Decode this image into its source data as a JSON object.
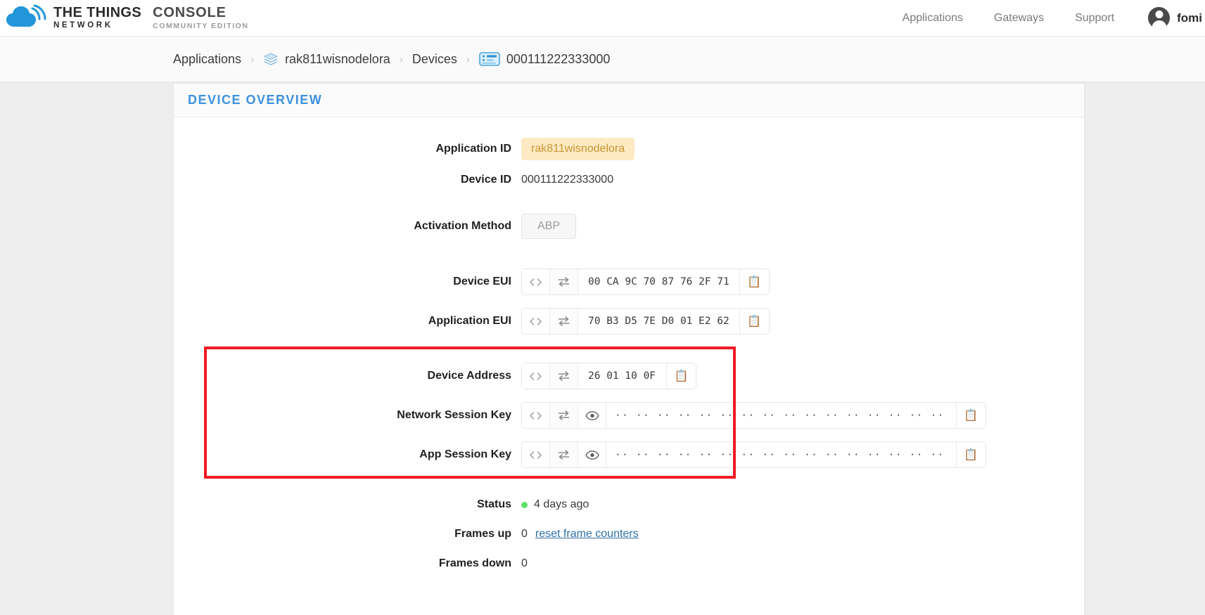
{
  "header": {
    "logo": {
      "icon": "ttn-cloud-icon",
      "line1": "THE THINGS",
      "line2": "NETWORK",
      "product_line1": "CONSOLE",
      "product_line2": "COMMUNITY EDITION"
    },
    "nav": [
      {
        "label": "Applications",
        "name": "nav-applications"
      },
      {
        "label": "Gateways",
        "name": "nav-gateways"
      },
      {
        "label": "Support",
        "name": "nav-support"
      }
    ],
    "user": {
      "name": "fomi",
      "avatar_icon": "user-avatar-icon"
    }
  },
  "breadcrumb": {
    "separator": "›",
    "items": [
      {
        "label": "Applications",
        "icon": null
      },
      {
        "label": "rak811wisnodelora",
        "icon": "layers-icon"
      },
      {
        "label": "Devices",
        "icon": null
      },
      {
        "label": "000111222333000",
        "icon": "device-chip-icon"
      }
    ]
  },
  "card": {
    "title": "DEVICE OVERVIEW"
  },
  "fields": {
    "application_id": {
      "label": "Application ID",
      "value": "rak811wisnodelora",
      "tag_bg": "#fdeac4",
      "tag_fg": "#c9962f"
    },
    "device_id": {
      "label": "Device ID",
      "value": "000111222333000"
    },
    "activation_method": {
      "label": "Activation Method",
      "value": "ABP"
    },
    "device_eui": {
      "label": "Device EUI",
      "value": "00 CA 9C 70 87 76 2F 71"
    },
    "application_eui": {
      "label": "Application EUI",
      "value": "70 B3 D5 7E D0 01 E2 62"
    },
    "device_address": {
      "label": "Device Address",
      "value": "26 01 10 0F"
    },
    "network_session_key": {
      "label": "Network Session Key",
      "value": "·· ·· ·· ·· ·· ·· ·· ·· ·· ·· ·· ·· ·· ·· ·· ··",
      "masked": true
    },
    "app_session_key": {
      "label": "App Session Key",
      "value": "·· ·· ·· ·· ·· ·· ·· ·· ·· ·· ·· ·· ·· ·· ·· ··",
      "masked": true
    },
    "status": {
      "label": "Status",
      "value": "4 days ago",
      "dot_color": "#5fe06a"
    },
    "frames_up": {
      "label": "Frames up",
      "value": "0",
      "link_label": "reset frame counters"
    },
    "frames_down": {
      "label": "Frames down",
      "value": "0"
    }
  },
  "icons": {
    "code_toggle": "<>",
    "swap_endian": "swap-arrows-icon",
    "eye": "eye-icon",
    "clipboard": "📋"
  },
  "highlight": {
    "color": "#ee1b24",
    "name": "red-highlight-box"
  }
}
